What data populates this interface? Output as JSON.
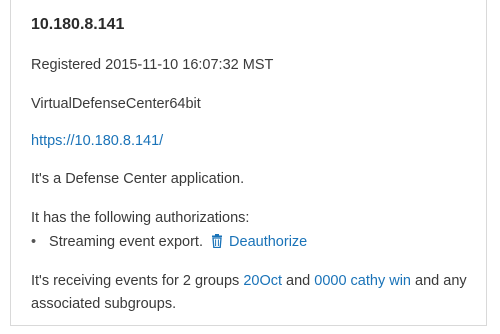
{
  "device": {
    "title": "10.180.8.141",
    "registered": "Registered 2015-11-10  16:07:32  MST",
    "model": "VirtualDefenseCenter64bit",
    "url": "https://10.180.8.141/",
    "description": "It's a Defense Center application.",
    "auth_heading": "It has the following authorizations:",
    "authorizations": [
      {
        "label": "Streaming event export.",
        "action_label": "Deauthorize",
        "icon": "trash-icon"
      }
    ],
    "events_prefix": "It's receiving events for 2 groups ",
    "group_1": "20Oct",
    "events_and": " and ",
    "group_2": "0000 cathy win",
    "events_suffix": " and any associated subgroups."
  },
  "colors": {
    "link": "#1a73b8",
    "text": "#3a3a3a",
    "border": "#d9d9d9"
  }
}
